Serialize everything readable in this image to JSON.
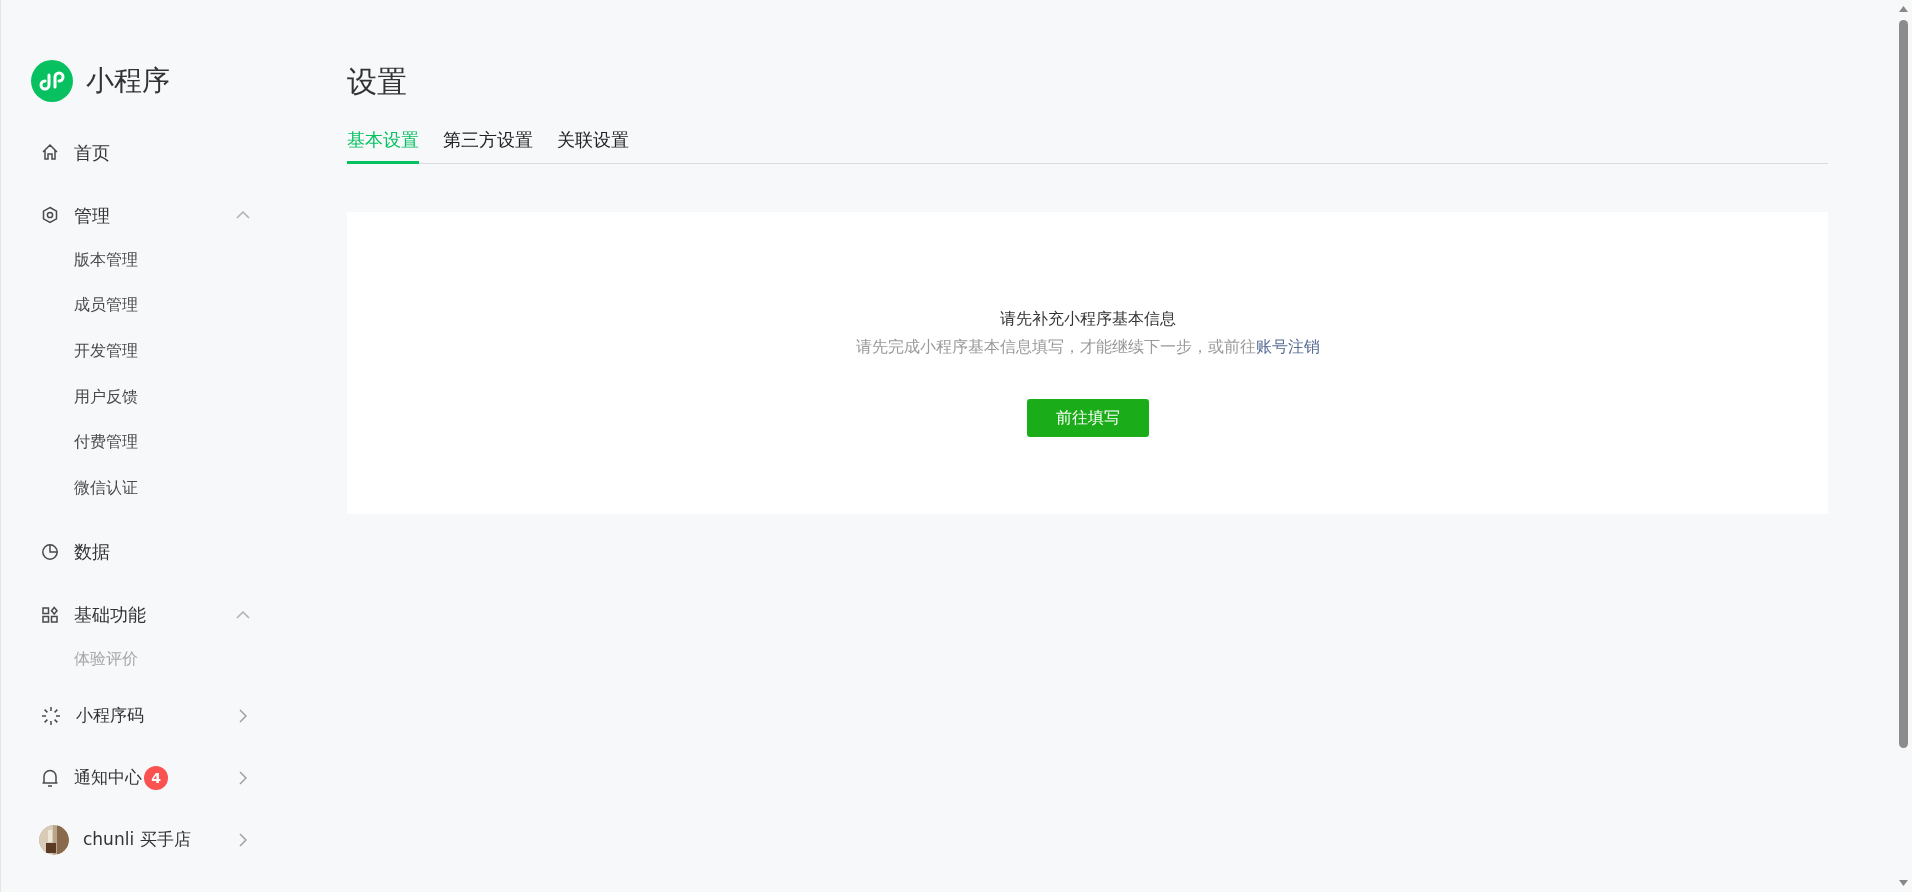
{
  "brand": {
    "title": "小程序"
  },
  "nav": [
    {
      "label": "首页"
    },
    {
      "label": "管理",
      "expanded": true,
      "children": [
        {
          "label": "版本管理"
        },
        {
          "label": "成员管理"
        },
        {
          "label": "开发管理"
        },
        {
          "label": "用户反馈"
        },
        {
          "label": "付费管理"
        },
        {
          "label": "微信认证"
        }
      ]
    },
    {
      "label": "数据"
    },
    {
      "label": "基础功能",
      "expanded": true,
      "children": [
        {
          "label": "体验评价",
          "faded": true
        }
      ]
    }
  ],
  "footer_nav": [
    {
      "label": "小程序码"
    },
    {
      "label": "通知中心",
      "badge": "4"
    },
    {
      "label": "chunli 买手店"
    }
  ],
  "page": {
    "title": "设置",
    "tabs": [
      {
        "label": "基本设置",
        "selected": true
      },
      {
        "label": "第三方设置",
        "selected": false
      },
      {
        "label": "关联设置",
        "selected": false
      }
    ],
    "notice": {
      "title": "请先补充小程序基本信息",
      "text": "请先完成小程序基本信息填写，才能继续下一步，或前往",
      "link": "账号注销",
      "button": "前往填写"
    }
  }
}
